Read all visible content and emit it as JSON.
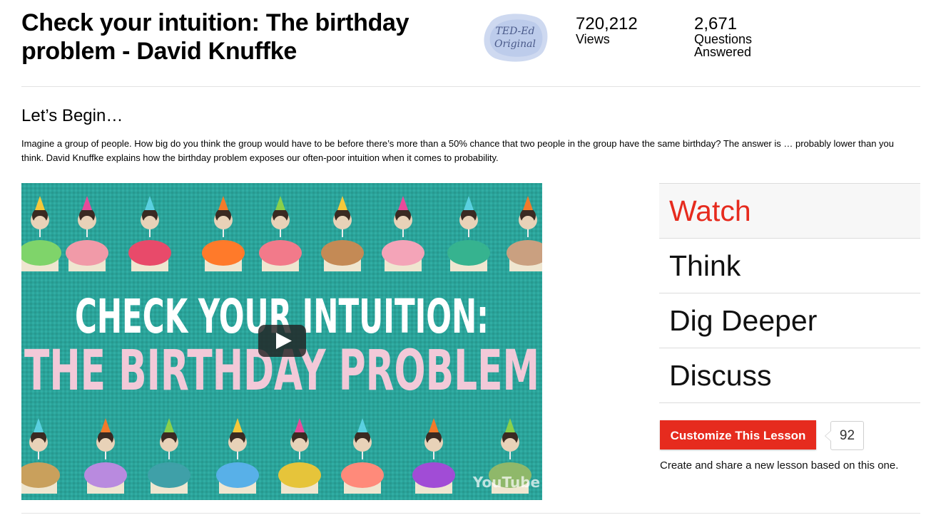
{
  "lesson": {
    "title": "Check your intuition: The birthday problem - David Knuffke",
    "badge_text": "TED-Ed Original"
  },
  "stats": {
    "views_value": "720,212",
    "views_label": "Views",
    "questions_value": "2,671",
    "questions_label_1": "Questions",
    "questions_label_2": "Answered"
  },
  "intro": {
    "heading": "Let’s Begin…",
    "description": "Imagine a group of people. How big do you think the group would have to be before there’s more than a 50% chance that two people in the group have the same birthday? The answer is … probably lower than you think. David Knuffke explains how the birthday problem exposes our often-poor intuition when it comes to probability."
  },
  "video": {
    "title_line_1": "CHECK YOUR INTUITION:",
    "title_line_2": "THE BIRTHDAY PROBLEM",
    "watermark": "YouTube",
    "background_color": "#2aa39a"
  },
  "nav": {
    "items": [
      "Watch",
      "Think",
      "Dig Deeper",
      "Discuss"
    ],
    "active": "Watch"
  },
  "customize": {
    "button_label": "Customize This Lesson",
    "count": "92",
    "note": "Create and share a new lesson based on this one."
  },
  "colors": {
    "accent": "#e62b1e"
  }
}
